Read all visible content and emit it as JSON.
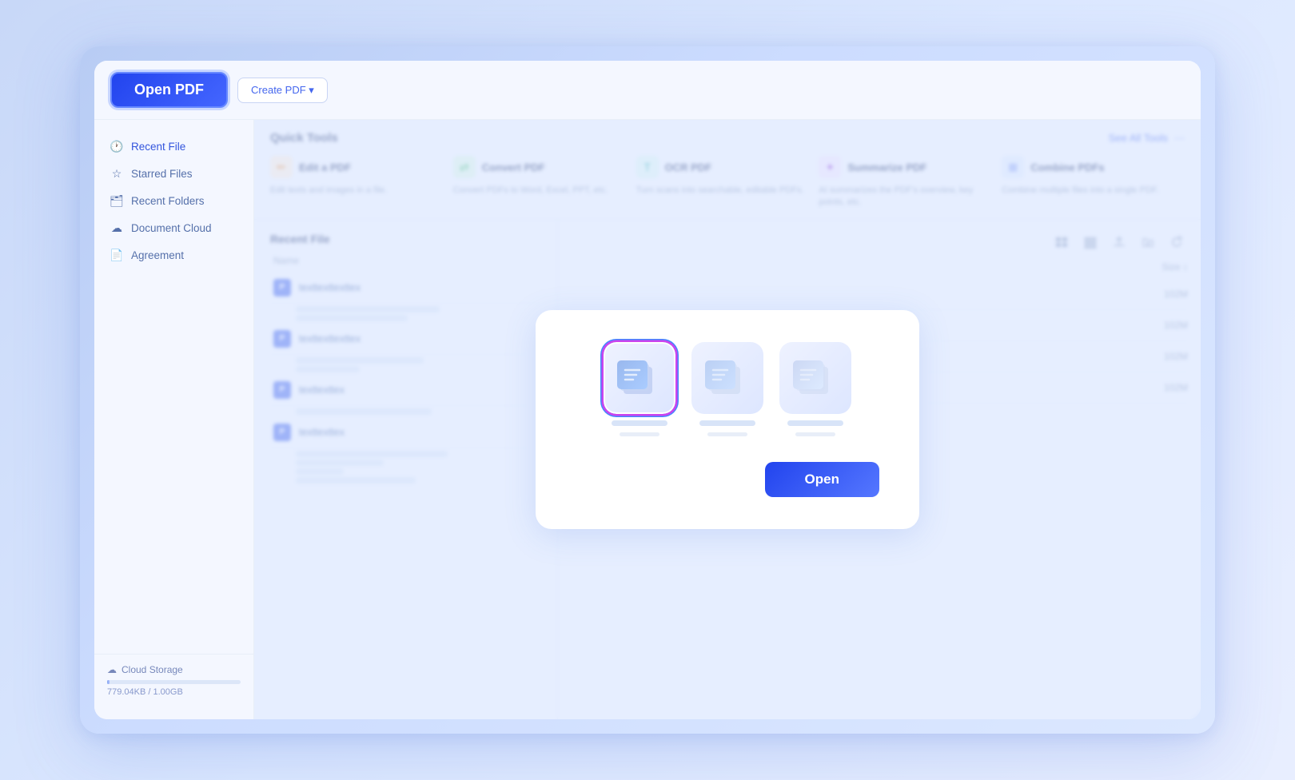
{
  "header": {
    "open_pdf_label": "Open PDF",
    "create_pdf_label": "Create PDF ▾"
  },
  "sidebar": {
    "items": [
      {
        "id": "recent-file",
        "label": "Recent File",
        "icon": "🕐",
        "active": true
      },
      {
        "id": "starred-files",
        "label": "Starred Files",
        "icon": "☆",
        "active": false
      },
      {
        "id": "recent-folders",
        "label": "Recent Folders",
        "icon": "🗂",
        "active": false
      },
      {
        "id": "document-cloud",
        "label": "Document Cloud",
        "icon": "☁",
        "active": false
      },
      {
        "id": "agreement",
        "label": "Agreement",
        "icon": "📄",
        "active": false
      }
    ],
    "storage": {
      "label": "Cloud Storage",
      "used": "779.04KB",
      "total": "1.00GB",
      "display": "779.04KB / 1.00GB",
      "percent": 2
    }
  },
  "quick_tools": {
    "title": "Quick Tools",
    "see_all_label": "See All Tools",
    "more_label": "···",
    "tools": [
      {
        "id": "edit-pdf",
        "name": "Edit a PDF",
        "desc": "Edit texts and images in a file.",
        "icon_color": "orange",
        "icon_char": "✏"
      },
      {
        "id": "convert-pdf",
        "name": "Convert PDF",
        "desc": "Convert PDFs to Word, Excel, PPT, etc.",
        "icon_color": "green",
        "icon_char": "⇄"
      },
      {
        "id": "ocr-pdf",
        "name": "OCR PDF",
        "desc": "Turn scans into searchable, editable PDFs.",
        "icon_color": "teal",
        "icon_char": "T"
      },
      {
        "id": "summarize-pdf",
        "name": "Summarize PDF",
        "desc": "AI summarizes the PDF's overview, key points, etc.",
        "icon_color": "purple",
        "icon_char": "✦"
      },
      {
        "id": "combine-pdfs",
        "name": "Combine PDFs",
        "desc": "Combine multiple files into a single PDF.",
        "icon_color": "blue",
        "icon_char": "⊞"
      }
    ]
  },
  "recent_files": {
    "title": "Recent File",
    "column_name": "Name",
    "files": [
      {
        "name": "texttexttexttex"
      },
      {
        "name": "texttexttexttex"
      },
      {
        "name": "texttexttex"
      },
      {
        "name": "texttexttex"
      }
    ]
  },
  "right_panel": {
    "size_header": "Size ↕",
    "sizes": [
      "102M",
      "102M",
      "102M",
      "102M"
    ]
  },
  "dialog": {
    "open_label": "Open",
    "files": [
      {
        "id": "file-1",
        "selected": true
      },
      {
        "id": "file-2",
        "selected": false
      },
      {
        "id": "file-3",
        "selected": false
      }
    ]
  }
}
